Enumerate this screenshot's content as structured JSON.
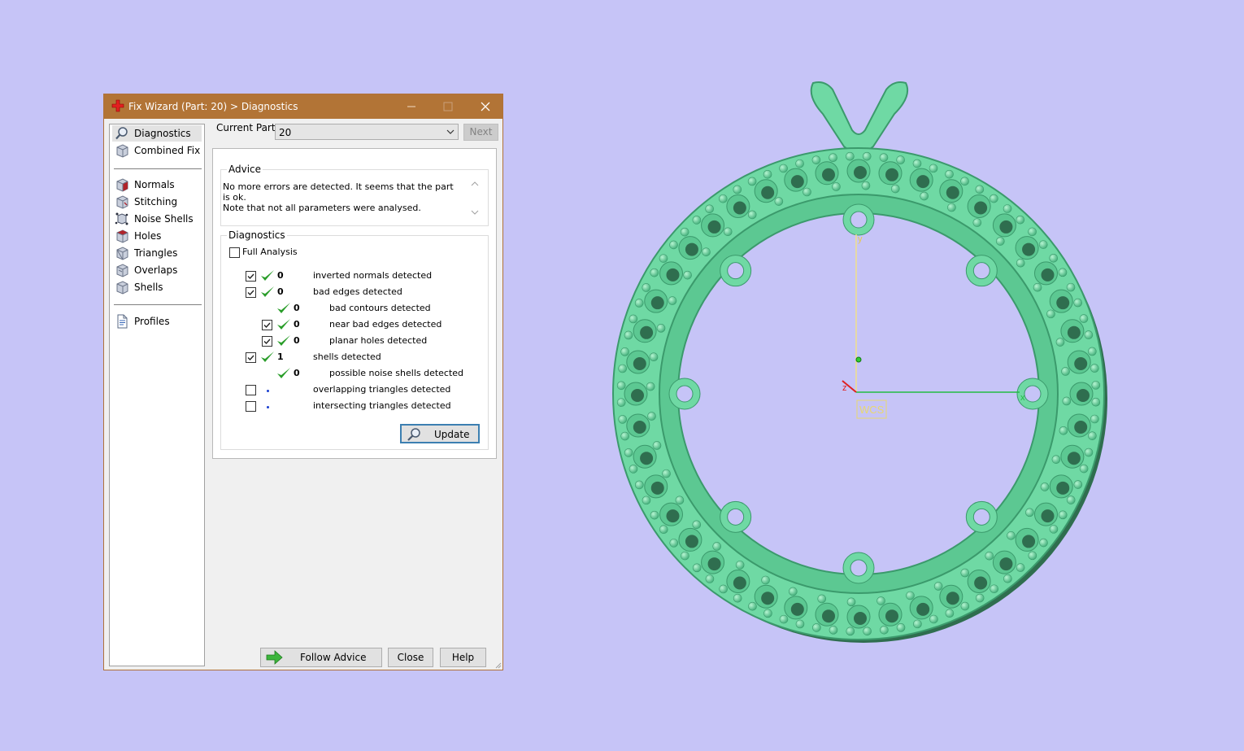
{
  "window": {
    "title": "Fix Wizard (Part: 20) > Diagnostics"
  },
  "nav": {
    "group1": [
      {
        "label": "Diagnostics",
        "icon": "magnifier-icon",
        "selected": true
      },
      {
        "label": "Combined Fix",
        "icon": "cube-icon"
      }
    ],
    "group2": [
      {
        "label": "Normals",
        "icon": "normals-cube-icon"
      },
      {
        "label": "Stitching",
        "icon": "stitching-cube-icon"
      },
      {
        "label": "Noise Shells",
        "icon": "noise-shells-icon"
      },
      {
        "label": "Holes",
        "icon": "holes-cube-icon"
      },
      {
        "label": "Triangles",
        "icon": "triangles-cube-icon"
      },
      {
        "label": "Overlaps",
        "icon": "overlaps-cube-icon"
      },
      {
        "label": "Shells",
        "icon": "shells-cube-icon"
      }
    ],
    "group3": [
      {
        "label": "Profiles",
        "icon": "document-icon"
      }
    ]
  },
  "current_part": {
    "label": "Current Part:",
    "value": "20",
    "next_label": "Next"
  },
  "advice": {
    "title": "Advice",
    "line1": "No more errors are detected. It seems that the part is ok.",
    "line2": "Note that not all parameters were analysed."
  },
  "diagnostics": {
    "title": "Diagnostics",
    "full_analysis_label": "Full Analysis",
    "full_analysis_checked": false,
    "rows": [
      {
        "checkbox": true,
        "checked": true,
        "status": "ok",
        "count": "0",
        "label": "inverted normals detected",
        "indent": 0
      },
      {
        "checkbox": true,
        "checked": true,
        "status": "ok",
        "count": "0",
        "label": "bad edges detected",
        "indent": 0
      },
      {
        "checkbox": false,
        "checked": false,
        "status": "ok",
        "count": "0",
        "label": "bad contours detected",
        "indent": 1
      },
      {
        "checkbox": true,
        "checked": true,
        "status": "ok",
        "count": "0",
        "label": "near bad edges detected",
        "indent": 1
      },
      {
        "checkbox": true,
        "checked": true,
        "status": "ok",
        "count": "0",
        "label": "planar holes detected",
        "indent": 1
      },
      {
        "checkbox": true,
        "checked": true,
        "status": "ok",
        "count": "1",
        "label": "shells detected",
        "indent": 0
      },
      {
        "checkbox": false,
        "checked": false,
        "status": "ok",
        "count": "0",
        "label": "possible noise shells detected",
        "indent": 1
      },
      {
        "checkbox": true,
        "checked": false,
        "status": "none",
        "count": "",
        "label": "overlapping triangles detected",
        "indent": 0
      },
      {
        "checkbox": true,
        "checked": false,
        "status": "none",
        "count": "",
        "label": "intersecting triangles detected",
        "indent": 0
      }
    ],
    "update_label": "Update"
  },
  "buttons": {
    "follow_advice": "Follow Advice",
    "close": "Close",
    "help": "Help"
  },
  "viewport": {
    "wcs_label": "WCS",
    "axis_x": "x",
    "axis_y": "y",
    "axis_z": "z",
    "model_color": "#6fd9a4",
    "background_color": "#c6c4f7"
  }
}
